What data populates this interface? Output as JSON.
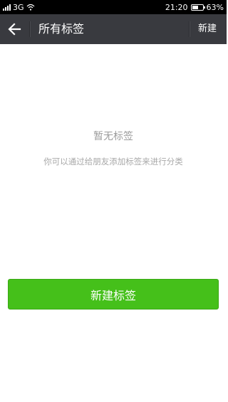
{
  "status_bar": {
    "network": "3G",
    "time": "21:20",
    "battery": "63%",
    "battery_level": 0.63
  },
  "app_bar": {
    "title": "所有标签",
    "action_label": "新建"
  },
  "empty_state": {
    "title": "暂无标签",
    "description": "你可以通过给朋友添加标签来进行分类"
  },
  "primary_button": {
    "label": "新建标签"
  },
  "colors": {
    "app_bar": "#393a3f",
    "primary": "#45c01a"
  }
}
